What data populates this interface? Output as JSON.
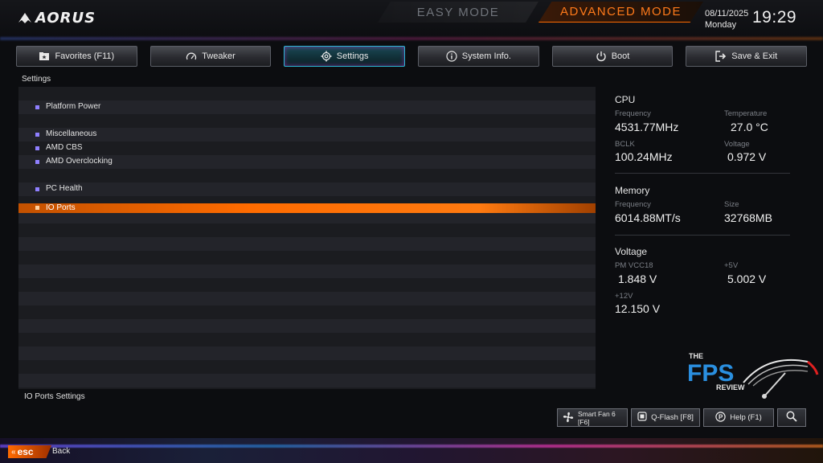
{
  "header": {
    "brand": "AORUS",
    "easy_mode": "EASY MODE",
    "advanced_mode": "ADVANCED MODE",
    "date": "08/11/2025",
    "day": "Monday",
    "time": "19:29"
  },
  "tabs": [
    {
      "label": "Favorites (F11)",
      "icon": "favorites-icon",
      "active": false
    },
    {
      "label": "Tweaker",
      "icon": "gauge-icon",
      "active": false
    },
    {
      "label": "Settings",
      "icon": "gear-icon",
      "active": true
    },
    {
      "label": "System Info.",
      "icon": "info-icon",
      "active": false
    },
    {
      "label": "Boot",
      "icon": "power-icon",
      "active": false
    },
    {
      "label": "Save & Exit",
      "icon": "exit-icon",
      "active": false
    }
  ],
  "breadcrumb": "Settings",
  "menu": {
    "items": [
      {
        "label": "Platform Power",
        "selected": false
      },
      {
        "label": "IO Ports",
        "selected": true
      },
      {
        "label": "Miscellaneous",
        "selected": false
      },
      {
        "label": "AMD CBS",
        "selected": false
      },
      {
        "label": "AMD Overclocking",
        "selected": false
      },
      {
        "label": "PC Health",
        "selected": false
      }
    ],
    "help_text": "IO Ports Settings"
  },
  "info": {
    "cpu": {
      "title": "CPU",
      "frequency_label": "Frequency",
      "frequency": "4531.77MHz",
      "temperature_label": "Temperature",
      "temperature": "27.0 °C",
      "bclk_label": "BCLK",
      "bclk": "100.24MHz",
      "voltage_label": "Voltage",
      "voltage": "0.972 V"
    },
    "memory": {
      "title": "Memory",
      "frequency_label": "Frequency",
      "frequency": "6014.88MT/s",
      "size_label": "Size",
      "size": "32768MB"
    },
    "voltage": {
      "title": "Voltage",
      "pm_vcc18_label": "PM VCC18",
      "pm_vcc18": "1.848 V",
      "plus5v_label": "+5V",
      "plus5v": "5.002 V",
      "plus12v_label": "+12V",
      "plus12v": "12.150 V"
    }
  },
  "watermark": {
    "the": "THE",
    "fps": "FPS",
    "review": "REVIEW"
  },
  "buttons": {
    "smart_fan": "Smart Fan 6 [F6]",
    "qflash": "Q-Flash [F8]",
    "help": "Help (F1)"
  },
  "footer": {
    "esc": "esc",
    "back": "Back"
  },
  "colors": {
    "accent_orange": "#ff6b00",
    "accent_cyan": "#2ab8d4",
    "bullet_purple": "#8f7fff",
    "fps_blue": "#2a8fe0"
  }
}
